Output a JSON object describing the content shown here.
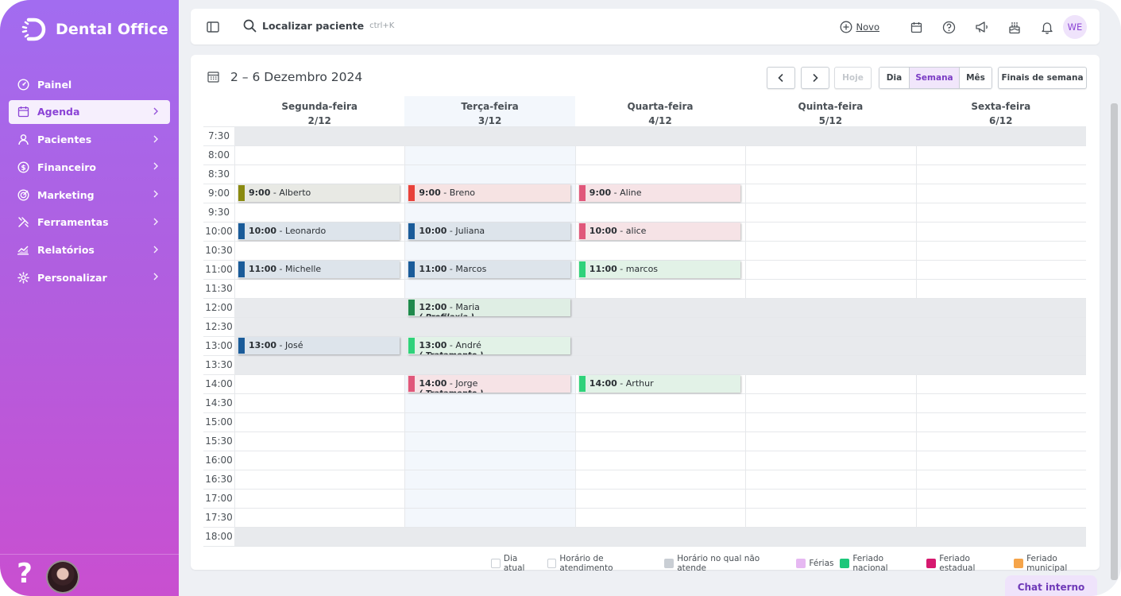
{
  "app": {
    "logo_text": "Dental Office",
    "accent": "#8b43d6"
  },
  "sidebar": {
    "items": [
      {
        "label": "Painel",
        "icon": "dashboard-icon",
        "chevron": false,
        "active": false
      },
      {
        "label": "Agenda",
        "icon": "calendar-icon",
        "chevron": true,
        "active": true
      },
      {
        "label": "Pacientes",
        "icon": "user-icon",
        "chevron": true,
        "active": false
      },
      {
        "label": "Financeiro",
        "icon": "dollar-icon",
        "chevron": true,
        "active": false
      },
      {
        "label": "Marketing",
        "icon": "target-icon",
        "chevron": true,
        "active": false
      },
      {
        "label": "Ferramentas",
        "icon": "tools-icon",
        "chevron": true,
        "active": false
      },
      {
        "label": "Relatórios",
        "icon": "chart-icon",
        "chevron": true,
        "active": false
      },
      {
        "label": "Personalizar",
        "icon": "gear-icon",
        "chevron": true,
        "active": false
      }
    ],
    "help_label": "?"
  },
  "topbar": {
    "search_label": "Localizar paciente",
    "search_hint": "ctrl+K",
    "new_label": "Novo",
    "avatar_initials": "WE"
  },
  "calendar": {
    "range": "2 – 6 Dezembro 2024",
    "today_label": "Hoje",
    "views": [
      "Dia",
      "Semana",
      "Mês"
    ],
    "active_view": "Semana",
    "weekends_label": "Finais de semana",
    "days": [
      {
        "name": "Segunda-feira",
        "date": "2/12"
      },
      {
        "name": "Terça-feira",
        "date": "3/12"
      },
      {
        "name": "Quarta-feira",
        "date": "4/12"
      },
      {
        "name": "Quinta-feira",
        "date": "5/12"
      },
      {
        "name": "Sexta-feira",
        "date": "6/12"
      }
    ],
    "times": [
      "7:30",
      "8:00",
      "8:30",
      "9:00",
      "9:30",
      "10:00",
      "10:30",
      "11:00",
      "11:30",
      "12:00",
      "12:30",
      "13:00",
      "13:30",
      "14:00",
      "14:30",
      "15:00",
      "15:30",
      "16:00",
      "16:30",
      "17:00",
      "17:30",
      "18:00"
    ],
    "events": [
      {
        "day": 0,
        "slot": 3,
        "time": "9:00",
        "name": "Alberto",
        "bar": "#8a8a10",
        "bg": "#e8e9e4",
        "note": ""
      },
      {
        "day": 0,
        "slot": 5,
        "time": "10:00",
        "name": "Leonardo",
        "bar": "#1a5b99",
        "bg": "#dde4eb",
        "note": ""
      },
      {
        "day": 0,
        "slot": 7,
        "time": "11:00",
        "name": "Michelle",
        "bar": "#1a5b99",
        "bg": "#dde4eb",
        "note": ""
      },
      {
        "day": 0,
        "slot": 11,
        "time": "13:00",
        "name": "José",
        "bar": "#1a5b99",
        "bg": "#dde4eb",
        "note": ""
      },
      {
        "day": 1,
        "slot": 3,
        "time": "9:00",
        "name": "Breno",
        "bar": "#e8413a",
        "bg": "#f6e3e3",
        "note": ""
      },
      {
        "day": 1,
        "slot": 5,
        "time": "10:00",
        "name": "Juliana",
        "bar": "#1a5b99",
        "bg": "#dde4eb",
        "note": ""
      },
      {
        "day": 1,
        "slot": 7,
        "time": "11:00",
        "name": "Marcos",
        "bar": "#1a5b99",
        "bg": "#dde4eb",
        "note": ""
      },
      {
        "day": 1,
        "slot": 9,
        "time": "12:00",
        "name": "Maria",
        "bar": "#1f8a4c",
        "bg": "#dfeee4",
        "note": "( Profilaxia )"
      },
      {
        "day": 1,
        "slot": 11,
        "time": "13:00",
        "name": "André",
        "bar": "#2fd27a",
        "bg": "#e2f2e7",
        "note": "( Tratamento )"
      },
      {
        "day": 1,
        "slot": 13,
        "time": "14:00",
        "name": "Jorge",
        "bar": "#e0577a",
        "bg": "#f6e3e6",
        "note": "( Tratamento )"
      },
      {
        "day": 2,
        "slot": 3,
        "time": "9:00",
        "name": "Aline",
        "bar": "#e0577a",
        "bg": "#f6e3e6",
        "note": ""
      },
      {
        "day": 2,
        "slot": 5,
        "time": "10:00",
        "name": "alice",
        "bar": "#e0577a",
        "bg": "#f6e3e6",
        "note": ""
      },
      {
        "day": 2,
        "slot": 7,
        "time": "11:00",
        "name": "marcos",
        "bar": "#2fd27a",
        "bg": "#e2f2e7",
        "note": ""
      },
      {
        "day": 2,
        "slot": 13,
        "time": "14:00",
        "name": "Arthur",
        "bar": "#2fd27a",
        "bg": "#e2f2e7",
        "note": ""
      }
    ],
    "closed_slots": [
      0,
      9,
      10,
      11,
      12,
      21
    ]
  },
  "legend": [
    {
      "label": "Dia atual",
      "color": "#ffffff"
    },
    {
      "label": "Horário de atendimento",
      "color": "#ffffff"
    },
    {
      "label": "Horário no qual não atende",
      "color": "#c9ced4"
    },
    {
      "label": "Férias",
      "color": "#e6b8f2"
    },
    {
      "label": "Feriado nacional",
      "color": "#1cc77a"
    },
    {
      "label": "Feriado estadual",
      "color": "#d6196f"
    },
    {
      "label": "Feriado municipal",
      "color": "#f5a44a"
    }
  ],
  "chat_label": "Chat interno"
}
